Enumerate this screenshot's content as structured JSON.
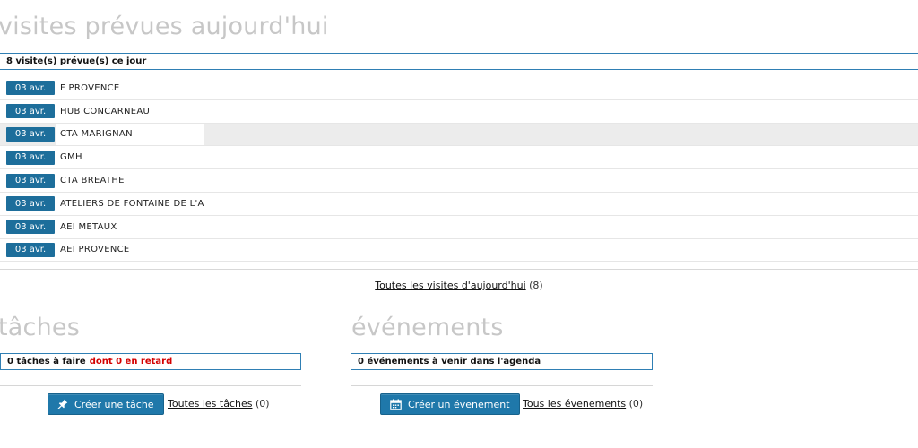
{
  "visits": {
    "title": "visites prévues aujourd'hui",
    "summary": "8 visite(s) prévue(s) ce jour",
    "items": [
      {
        "date": "03 avr.",
        "name": "F PROVENCE"
      },
      {
        "date": "03 avr.",
        "name": "HUB CONCARNEAU"
      },
      {
        "date": "03 avr.",
        "name": "CTA MARIGNAN"
      },
      {
        "date": "03 avr.",
        "name": "GMH"
      },
      {
        "date": "03 avr.",
        "name": "CTA BREATHE"
      },
      {
        "date": "03 avr.",
        "name": "ATELIERS DE FONTAINE DE L'ANE"
      },
      {
        "date": "03 avr.",
        "name": "AEI METAUX"
      },
      {
        "date": "03 avr.",
        "name": "AEI PROVENCE"
      }
    ],
    "all_link": "Toutes les visites d'aujourd'hui",
    "all_count": "(8)"
  },
  "tasks": {
    "title": "tâches",
    "summary": "0 tâches à faire",
    "late": "dont 0 en retard",
    "create_label": "Créer une tâche",
    "create_icon": "pin-icon",
    "all_link": "Toutes les tâches",
    "all_count": "(0)"
  },
  "events": {
    "title": "événements",
    "summary": "0 événements à venir dans l'agenda",
    "create_label": "Créer un évenement",
    "create_icon": "calendar-icon",
    "all_link": "Tous les évenements",
    "all_count": "(0)"
  },
  "colors": {
    "accent": "#1f78aa",
    "late": "#d40000",
    "title": "#c7c7c7"
  }
}
